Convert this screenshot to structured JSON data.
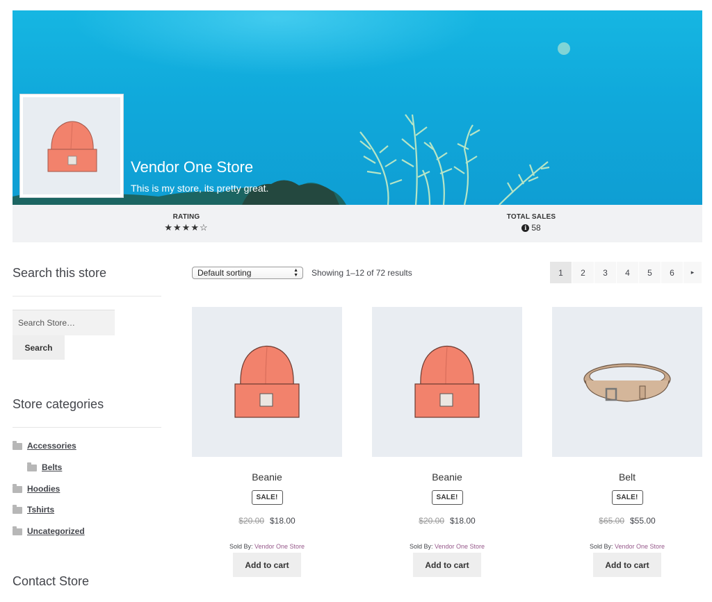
{
  "store": {
    "name": "Vendor One Store",
    "description": "This is my store, its pretty great.",
    "rating_label": "RATING",
    "rating_stars": "★★★★☆",
    "rating_value": 4,
    "rating_max": 5,
    "total_sales_label": "TOTAL SALES",
    "total_sales_icon": "info-icon",
    "total_sales": "58"
  },
  "sidebar": {
    "search_title": "Search this store",
    "search_placeholder": "Search Store…",
    "search_button": "Search",
    "categories_title": "Store categories",
    "categories": [
      {
        "label": "Accessories",
        "icon": "folder-icon"
      },
      {
        "label": "Belts",
        "icon": "folder-icon"
      },
      {
        "label": "Hoodies",
        "icon": "folder-icon"
      },
      {
        "label": "Tshirts",
        "icon": "folder-icon"
      },
      {
        "label": "Uncategorized",
        "icon": "folder-icon"
      }
    ],
    "contact_title": "Contact Store"
  },
  "toolbar": {
    "sort_selected": "Default sorting",
    "result_count": "Showing 1–12 of 72 results",
    "pages": [
      "1",
      "2",
      "3",
      "4",
      "5",
      "6"
    ],
    "current_page": "1",
    "next_icon": "▸"
  },
  "products": [
    {
      "title": "Beanie",
      "badge": "SALE!",
      "old_price": "$20.00",
      "price": "$18.00",
      "sold_by_label": "Sold By:",
      "vendor": "Vendor One Store",
      "button": "Add to cart",
      "image": "beanie-image"
    },
    {
      "title": "Beanie",
      "badge": "SALE!",
      "old_price": "$20.00",
      "price": "$18.00",
      "sold_by_label": "Sold By:",
      "vendor": "Vendor One Store",
      "button": "Add to cart",
      "image": "beanie-image"
    },
    {
      "title": "Belt",
      "badge": "SALE!",
      "old_price": "$65.00",
      "price": "$55.00",
      "sold_by_label": "Sold By:",
      "vendor": "Vendor One Store",
      "button": "Add to cart",
      "image": "belt-image"
    }
  ],
  "colors": {
    "banner_blue": "#10a9db",
    "stats_bg": "#f1f2f4",
    "vendor_link": "#96588a",
    "beanie": "#f2826c"
  }
}
